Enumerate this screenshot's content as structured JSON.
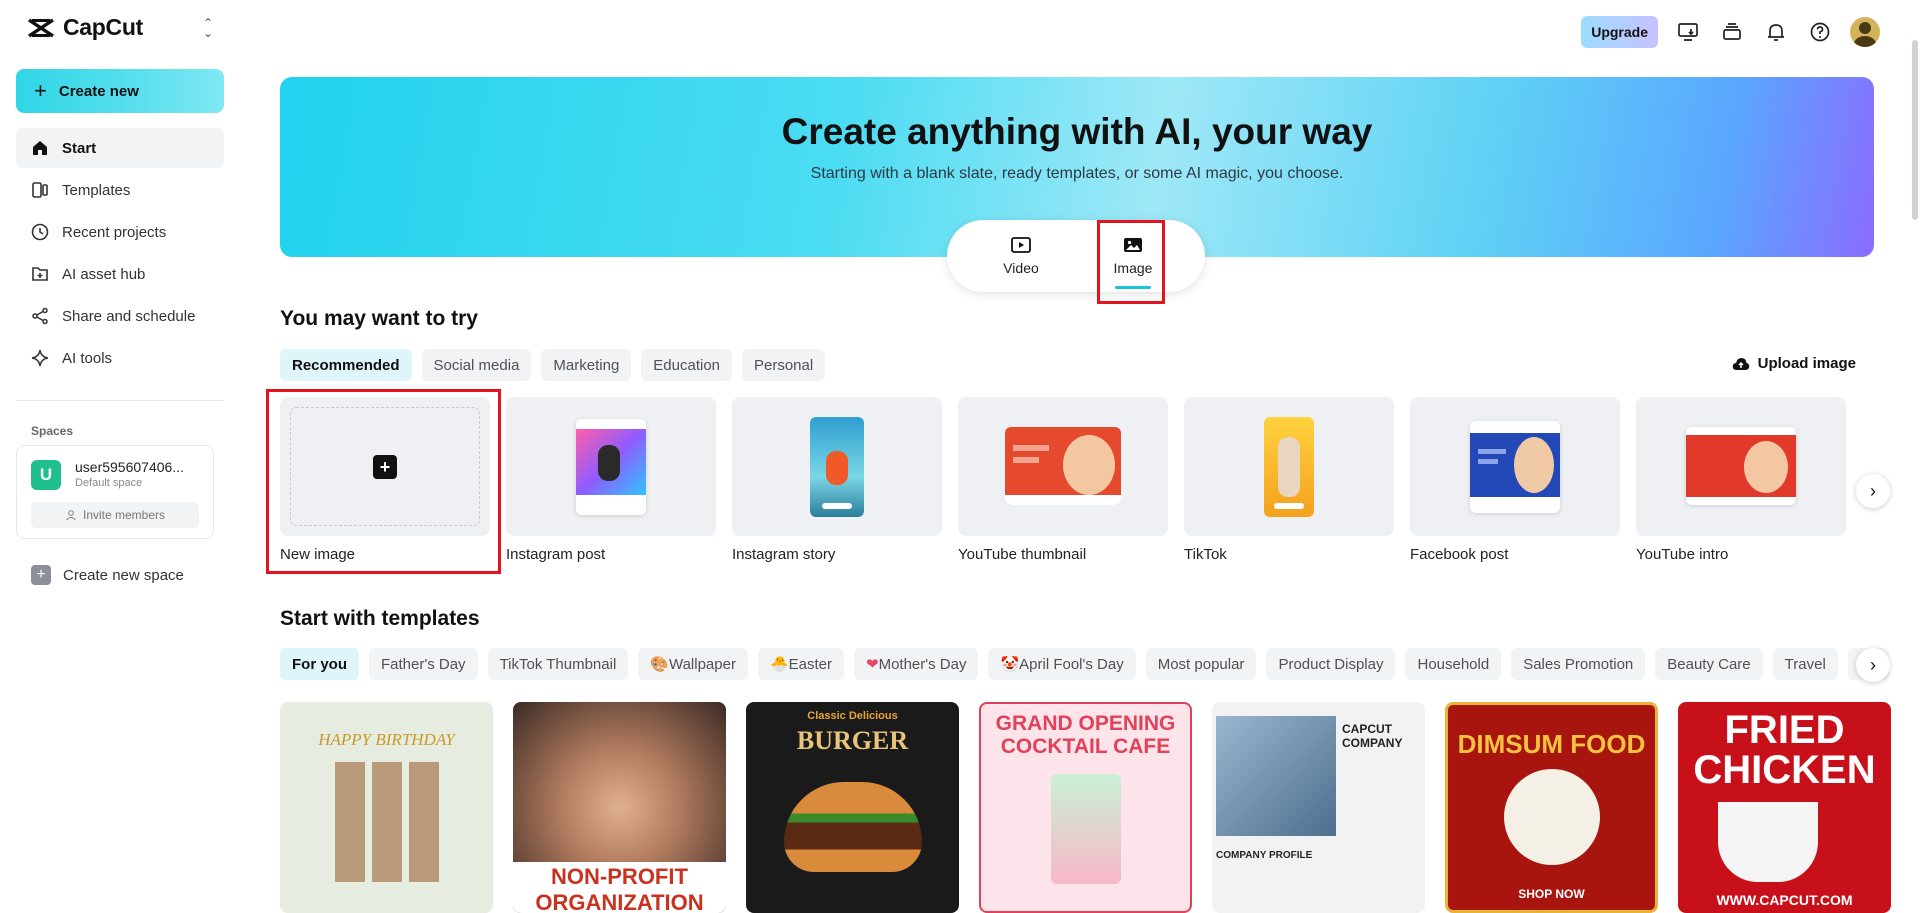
{
  "app": {
    "name": "CapCut"
  },
  "sidebar": {
    "create_label": "Create new",
    "items": [
      {
        "label": "Start",
        "icon": "home-icon"
      },
      {
        "label": "Templates",
        "icon": "templates-icon"
      },
      {
        "label": "Recent projects",
        "icon": "clock-icon"
      },
      {
        "label": "AI asset hub",
        "icon": "asset-hub-icon"
      },
      {
        "label": "Share and schedule",
        "icon": "share-icon"
      },
      {
        "label": "AI tools",
        "icon": "sparkle-icon"
      }
    ],
    "spaces_label": "Spaces",
    "space": {
      "initial": "U",
      "name": "user595607406...",
      "sub": "Default space",
      "invite_label": "Invite members"
    },
    "new_space_label": "Create new space"
  },
  "topbar": {
    "upgrade_label": "Upgrade"
  },
  "hero": {
    "title": "Create anything with AI, your way",
    "subtitle": "Starting with a blank slate, ready templates, or some AI magic, you choose.",
    "modes": [
      {
        "label": "Video"
      },
      {
        "label": "Image"
      }
    ],
    "active_mode": "Image"
  },
  "try": {
    "title": "You may want to try",
    "tabs": [
      "Recommended",
      "Social media",
      "Marketing",
      "Education",
      "Personal"
    ],
    "active_tab": "Recommended",
    "upload_label": "Upload image",
    "cards": [
      "New image",
      "Instagram post",
      "Instagram story",
      "YouTube thumbnail",
      "TikTok",
      "Facebook post",
      "YouTube intro"
    ]
  },
  "templates": {
    "title": "Start with templates",
    "tabs": [
      "For you",
      "Father's Day",
      "TikTok Thumbnail",
      "Wallpaper",
      "Easter",
      "Mother's Day",
      "April Fool's Day",
      "Most popular",
      "Product Display",
      "Household",
      "Sales Promotion",
      "Beauty Care",
      "Travel",
      "Fo"
    ],
    "active_tab": "For you",
    "items": [
      {
        "text": "HAPPY BIRTHDAY",
        "bg": "#e6ece0"
      },
      {
        "text": "NON-PROFIT ORGANIZATION",
        "bg": "#c8321e"
      },
      {
        "text": "BURGER",
        "sub": "Classic Delicious",
        "bg": "#1a1a1a"
      },
      {
        "text": "GRAND OPENING COCKTAIL CAFE",
        "bg": "#fde4ea"
      },
      {
        "text": "CAPCUT COMPANY",
        "sub": "COMPANY PROFILE",
        "bg": "#f2f2f2"
      },
      {
        "text": "DIMSUM FOOD",
        "sub": "SHOP NOW",
        "bg": "#a8150f"
      },
      {
        "text": "FRIED CHICKEN",
        "sub": "WWW.CAPCUT.COM",
        "bg": "#c8101a"
      }
    ]
  },
  "colors": {
    "accent": "#1ac6d8",
    "highlight": "#e3141e"
  }
}
